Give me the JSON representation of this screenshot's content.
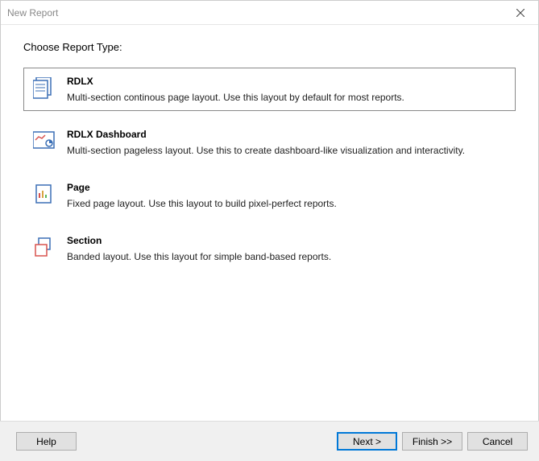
{
  "window": {
    "title": "New Report"
  },
  "heading": "Choose Report Type:",
  "options": [
    {
      "title": "RDLX",
      "desc": "Multi-section continous page layout. Use this layout by default for most reports."
    },
    {
      "title": "RDLX Dashboard",
      "desc": "Multi-section pageless layout. Use this to create dashboard-like visualization and interactivity."
    },
    {
      "title": "Page",
      "desc": "Fixed page layout. Use this layout to build pixel-perfect reports."
    },
    {
      "title": "Section",
      "desc": "Banded layout. Use this layout for simple band-based reports."
    }
  ],
  "buttons": {
    "help": "Help",
    "next": "Next >",
    "finish": "Finish >>",
    "cancel": "Cancel"
  }
}
